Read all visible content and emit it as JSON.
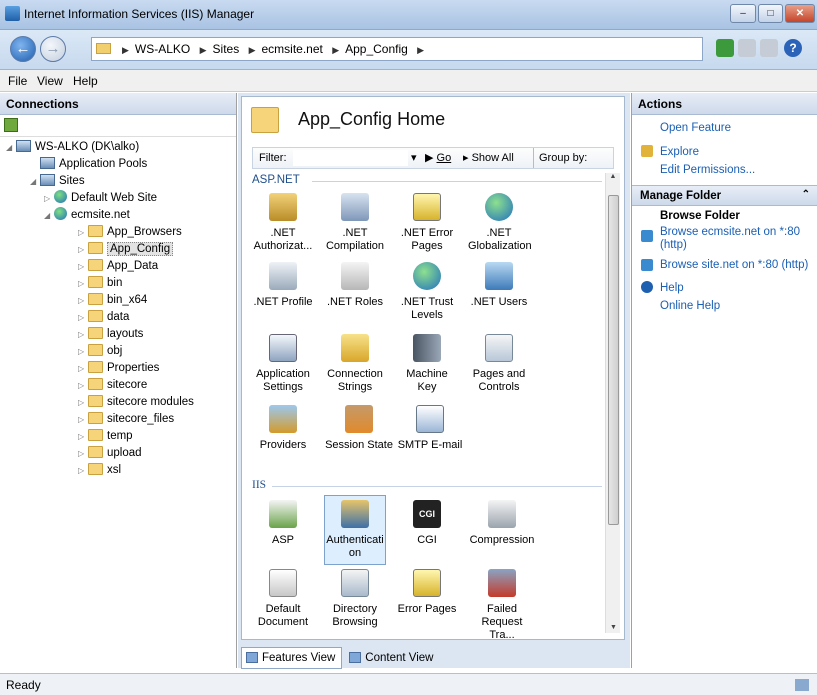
{
  "window": {
    "title": "Internet Information Services (IIS) Manager"
  },
  "breadcrumb": [
    "WS-ALKO",
    "Sites",
    "ecmsite.net",
    "App_Config"
  ],
  "menu": [
    "File",
    "View",
    "Help"
  ],
  "connections": {
    "title": "Connections",
    "tree": [
      {
        "label": "WS-ALKO (DK\\alko)",
        "icon": "server-icon"
      },
      {
        "label": "Application Pools",
        "icon": "app-pools-icon"
      },
      {
        "label": "Sites",
        "icon": "sites-icon"
      },
      {
        "label": "Default Web Site",
        "icon": "globe-icon"
      },
      {
        "label": "ecmsite.net",
        "icon": "globe-icon"
      },
      {
        "label": "App_Browsers",
        "icon": "folder-icon"
      },
      {
        "label": "App_Config",
        "icon": "folder-icon",
        "selected": true
      },
      {
        "label": "App_Data",
        "icon": "folder-icon"
      },
      {
        "label": "bin",
        "icon": "folder-icon"
      },
      {
        "label": "bin_x64",
        "icon": "folder-icon"
      },
      {
        "label": "data",
        "icon": "folder-icon"
      },
      {
        "label": "layouts",
        "icon": "folder-icon"
      },
      {
        "label": "obj",
        "icon": "folder-icon"
      },
      {
        "label": "Properties",
        "icon": "folder-icon"
      },
      {
        "label": "sitecore",
        "icon": "folder-icon"
      },
      {
        "label": "sitecore modules",
        "icon": "folder-icon"
      },
      {
        "label": "sitecore_files",
        "icon": "folder-icon"
      },
      {
        "label": "temp",
        "icon": "folder-icon"
      },
      {
        "label": "upload",
        "icon": "folder-icon"
      },
      {
        "label": "xsl",
        "icon": "folder-icon"
      }
    ]
  },
  "main": {
    "title": "App_Config Home",
    "filter": {
      "label": "Filter:",
      "value": "",
      "go": "Go",
      "show_all": "Show All",
      "group_by": "Group by:"
    },
    "groups": [
      {
        "name": "ASP.NET",
        "features": [
          {
            "label": ".NET Authorizat...",
            "icon": "authorization-icon"
          },
          {
            "label": ".NET Compilation",
            "icon": "compilation-icon"
          },
          {
            "label": ".NET Error Pages",
            "icon": "error-pages-icon"
          },
          {
            "label": ".NET Globalization",
            "icon": "globalization-icon"
          },
          {
            "label": ".NET Profile",
            "icon": "profile-icon"
          },
          {
            "label": ".NET Roles",
            "icon": "roles-icon"
          },
          {
            "label": ".NET Trust Levels",
            "icon": "trust-levels-icon"
          },
          {
            "label": ".NET Users",
            "icon": "users-icon"
          },
          {
            "label": "Application Settings",
            "icon": "app-settings-icon"
          },
          {
            "label": "Connection Strings",
            "icon": "connection-strings-icon"
          },
          {
            "label": "Machine Key",
            "icon": "machine-key-icon"
          },
          {
            "label": "Pages and Controls",
            "icon": "pages-controls-icon"
          },
          {
            "label": "Providers",
            "icon": "providers-icon"
          },
          {
            "label": "Session State",
            "icon": "session-state-icon"
          },
          {
            "label": "SMTP E-mail",
            "icon": "smtp-icon"
          }
        ]
      },
      {
        "name": "IIS",
        "features": [
          {
            "label": "ASP",
            "icon": "asp-icon"
          },
          {
            "label": "Authenticati on",
            "icon": "authentication-icon",
            "selected": true
          },
          {
            "label": "CGI",
            "icon": "cgi-icon"
          },
          {
            "label": "Compression",
            "icon": "compression-icon"
          },
          {
            "label": "Default Document",
            "icon": "default-document-icon"
          },
          {
            "label": "Directory Browsing",
            "icon": "directory-browsing-icon"
          },
          {
            "label": "Error Pages",
            "icon": "error-pages-icon"
          },
          {
            "label": "Failed Request Tra...",
            "icon": "failed-request-icon"
          }
        ]
      }
    ],
    "view_tabs": [
      "Features View",
      "Content View"
    ]
  },
  "actions": {
    "title": "Actions",
    "open_feature": "Open Feature",
    "explore": "Explore",
    "edit_permissions": "Edit Permissions...",
    "manage_folder": "Manage Folder",
    "browse_folder": "Browse Folder",
    "browse_1": "Browse ecmsite.net on *:80 (http)",
    "browse_2": "Browse site.net on *:80 (http)",
    "help": "Help",
    "online_help": "Online Help"
  },
  "status": {
    "text": "Ready"
  },
  "colors": {
    "link": "#1a5fb4",
    "group": "#1e4e8c"
  }
}
